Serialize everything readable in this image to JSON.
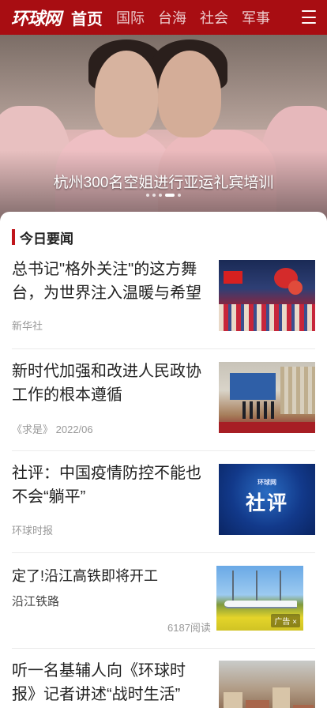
{
  "header": {
    "logo": "环球网",
    "nav": [
      "首页",
      "国际",
      "台海",
      "社会",
      "军事"
    ],
    "active_index": 0,
    "brand_color": "#a80d12",
    "menu_icon": "hamburger-menu-icon"
  },
  "banner": {
    "caption": "杭州300名空姐进行亚运礼宾培训",
    "dots_count": 5,
    "active_dot": 3
  },
  "section": {
    "title": "今日要闻",
    "accent_color": "#c0151b"
  },
  "news": [
    {
      "title": "总书记\"格外关注\"的这方舞台，为世界注入温暖与希望",
      "source": "新华社",
      "date": ""
    },
    {
      "title": "新时代加强和改进人民政协工作的根本遵循",
      "source": "《求是》",
      "date": "2022/06"
    },
    {
      "title": "社评：中国疫情防控不能也不会“躺平”",
      "source": "环球时报",
      "date": "",
      "thumb_brand": "环球网",
      "thumb_text": "社评"
    },
    {
      "title": "定了!沿江高铁即将开工",
      "subtitle": "沿江铁路",
      "reads": "6187阅读",
      "ad_label": "广告"
    },
    {
      "title": "听一名基辅人向《环球时报》记者讲述“战时生活”"
    }
  ]
}
